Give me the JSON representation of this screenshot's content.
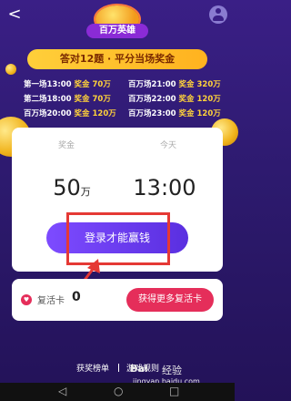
{
  "header": {
    "back_label": "<"
  },
  "logo": {
    "text": "百万英雄"
  },
  "slogan": "答对12题 · 平分当场奖金",
  "schedule": [
    {
      "left": "第一场13:00",
      "left_prize_label": "奖金",
      "left_prize_value": "70万",
      "right": "百万场21:00",
      "right_prize_label": "奖金",
      "right_prize_value": "320万"
    },
    {
      "left": "第二场18:00",
      "left_prize_label": "奖金",
      "left_prize_value": "70万",
      "right": "百万场22:00",
      "right_prize_label": "奖金",
      "right_prize_value": "120万"
    },
    {
      "left": "百万场20:00",
      "left_prize_label": "奖金",
      "left_prize_value": "120万",
      "right": "百万场23:00",
      "right_prize_label": "奖金",
      "right_prize_value": "120万"
    }
  ],
  "card": {
    "prize_label": "奖金",
    "prize_value": "50",
    "prize_unit": "万",
    "time_label": "今天",
    "time_value": "13:00",
    "login_button": "登录才能赢钱"
  },
  "revive": {
    "label": "复活卡",
    "count": "0",
    "button": "获得更多复活卡"
  },
  "footer": {
    "rank": "获奖榜单",
    "rules": "游戏规则"
  },
  "watermark": {
    "logo": "Bai",
    "brand": "经验",
    "url": "jingyan.baidu.com"
  },
  "navbar": {
    "back": "◁",
    "home": "○",
    "recent": "□"
  }
}
